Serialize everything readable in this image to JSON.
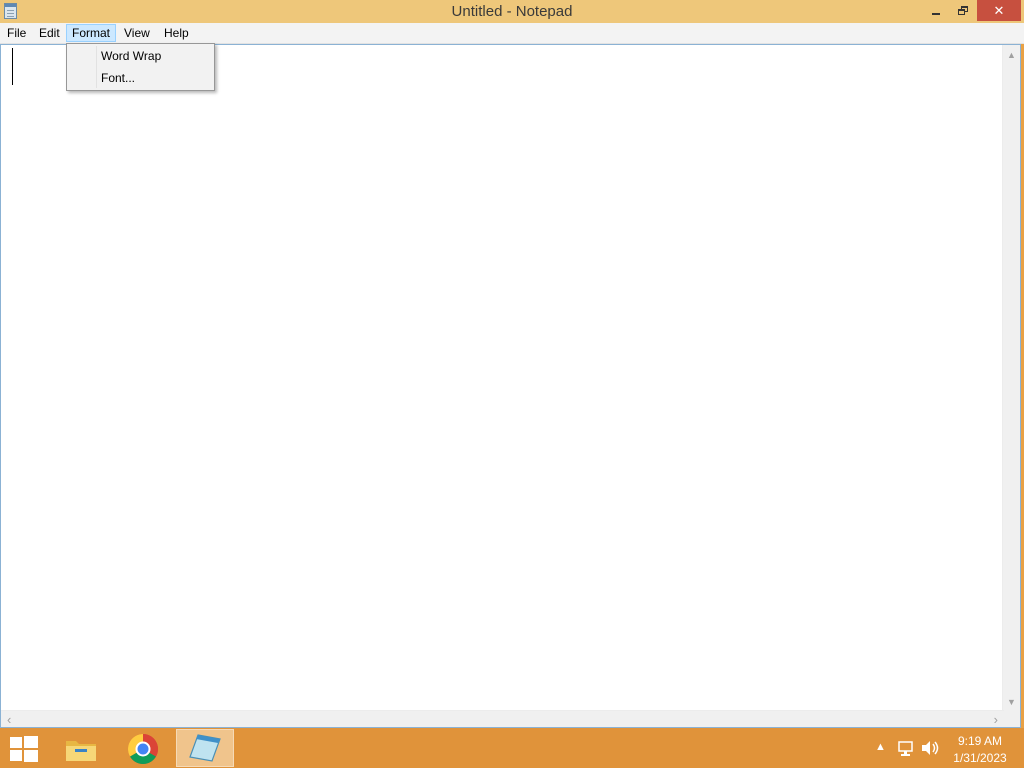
{
  "window": {
    "title": "Untitled - Notepad",
    "close_glyph": "✕"
  },
  "menubar": {
    "items": [
      {
        "label": "File"
      },
      {
        "label": "Edit"
      },
      {
        "label": "Format"
      },
      {
        "label": "View"
      },
      {
        "label": "Help"
      }
    ],
    "active": "Format"
  },
  "format_menu": {
    "items": [
      {
        "label": "Word Wrap"
      },
      {
        "label": "Font..."
      }
    ]
  },
  "editor": {
    "text": ""
  },
  "scrollbars": {
    "up_glyph": "▲",
    "down_glyph": "▼",
    "left_glyph": "‹",
    "right_glyph": "›"
  },
  "taskbar": {
    "icons": [
      "windows-logo-icon",
      "file-explorer-icon",
      "chrome-icon",
      "notepad-icon"
    ],
    "tray_up_glyph": "▲",
    "clock_time": "9:19 AM",
    "clock_date": "1/31/2023"
  },
  "colors": {
    "titlebar": "#eec77a",
    "close_button": "#c7503f",
    "taskbar": "#e0933a",
    "menu_highlight": "#cce8ff"
  }
}
